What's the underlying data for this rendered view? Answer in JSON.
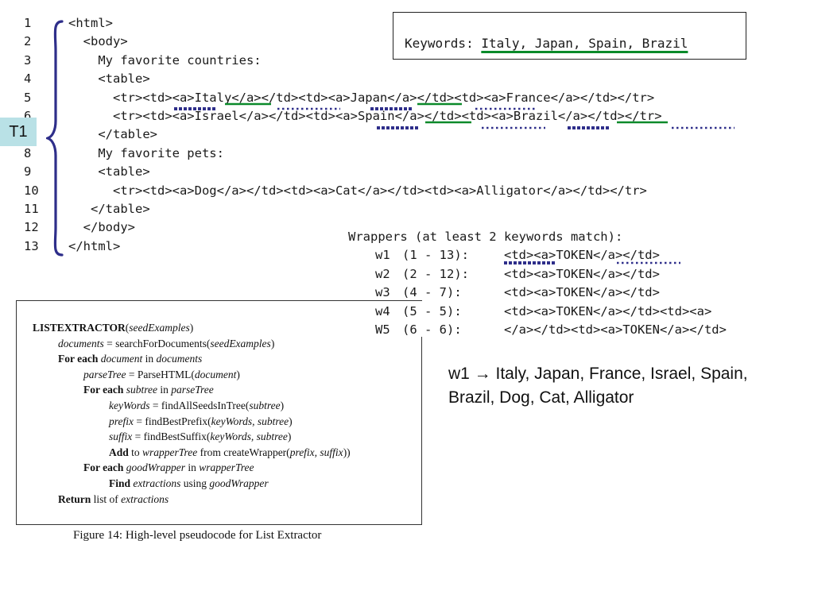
{
  "code": {
    "lines": [
      {
        "num": "1",
        "text": "<html>"
      },
      {
        "num": "2",
        "text": "  <body>"
      },
      {
        "num": "3",
        "text": "    My favorite countries:"
      },
      {
        "num": "4",
        "text": "    <table>"
      },
      {
        "num": "5",
        "text": "      <tr><td><a>Italy</a></td><td><a>Japan</a></td><td><a>France</a></td></tr>"
      },
      {
        "num": "6",
        "text": "      <tr><td><a>Israel</a></td><td><a>Spain</a></td><td><a>Brazil</a></td></tr>"
      },
      {
        "num": "7",
        "text": "    </table>"
      },
      {
        "num": "8",
        "text": "    My favorite pets:"
      },
      {
        "num": "9",
        "text": "    <table>"
      },
      {
        "num": "10",
        "text": "      <tr><td><a>Dog</a></td><td><a>Cat</a></td><td><a>Alligator</a></td></tr>"
      },
      {
        "num": "11",
        "text": "   </table>"
      },
      {
        "num": "12",
        "text": "  </body>"
      },
      {
        "num": "13",
        "text": "</html>"
      }
    ]
  },
  "tree_label": "T1",
  "keywords": {
    "label": "Keywords: ",
    "items": "Italy, Japan, Spain, Brazil"
  },
  "wrappers": {
    "header": "Wrappers (at least 2 keywords match):",
    "items": [
      {
        "name": "w1",
        "range": "(1 - 13):",
        "pattern": "<td><a>TOKEN</a></td>"
      },
      {
        "name": "w2",
        "range": "(2 - 12):",
        "pattern": "<td><a>TOKEN</a></td>"
      },
      {
        "name": "w3",
        "range": "(4 - 7):",
        "pattern": "<td><a>TOKEN</a></td>"
      },
      {
        "name": "w4",
        "range": "(5 - 5):",
        "pattern": "<td><a>TOKEN</a></td><td><a>"
      },
      {
        "name": "W5",
        "range": "(6 - 6):",
        "pattern": "</a></td><td><a>TOKEN</a></td>"
      }
    ]
  },
  "pseudocode": {
    "lines": [
      {
        "indent": 0,
        "parts": [
          {
            "t": "LISTEXTRACTOR",
            "s": "b"
          },
          {
            "t": "(",
            "s": ""
          },
          {
            "t": "seedExamples",
            "s": "i"
          },
          {
            "t": ")",
            "s": ""
          }
        ]
      },
      {
        "indent": 1,
        "parts": [
          {
            "t": "documents",
            "s": "i"
          },
          {
            "t": " = searchForDocuments(",
            "s": ""
          },
          {
            "t": "seedExamples",
            "s": "i"
          },
          {
            "t": ")",
            "s": ""
          }
        ]
      },
      {
        "indent": 1,
        "parts": [
          {
            "t": "For each",
            "s": "b"
          },
          {
            "t": " ",
            "s": ""
          },
          {
            "t": "document",
            "s": "i"
          },
          {
            "t": " in ",
            "s": ""
          },
          {
            "t": "documents",
            "s": "i"
          }
        ]
      },
      {
        "indent": 2,
        "parts": [
          {
            "t": "parseTree",
            "s": "i"
          },
          {
            "t": " = ParseHTML(",
            "s": ""
          },
          {
            "t": "document",
            "s": "i"
          },
          {
            "t": ")",
            "s": ""
          }
        ]
      },
      {
        "indent": 2,
        "parts": [
          {
            "t": "For each",
            "s": "b"
          },
          {
            "t": " ",
            "s": ""
          },
          {
            "t": "subtree",
            "s": "i"
          },
          {
            "t": " in ",
            "s": ""
          },
          {
            "t": "parseTree",
            "s": "i"
          }
        ]
      },
      {
        "indent": 3,
        "parts": [
          {
            "t": "keyWords",
            "s": "i"
          },
          {
            "t": " = findAllSeedsInTree(",
            "s": ""
          },
          {
            "t": "subtree",
            "s": "i"
          },
          {
            "t": ")",
            "s": ""
          }
        ]
      },
      {
        "indent": 3,
        "parts": [
          {
            "t": "prefix",
            "s": "i"
          },
          {
            "t": " = findBestPrefix(",
            "s": ""
          },
          {
            "t": "keyWords, subtree",
            "s": "i"
          },
          {
            "t": ")",
            "s": ""
          }
        ]
      },
      {
        "indent": 3,
        "parts": [
          {
            "t": "suffix",
            "s": "i"
          },
          {
            "t": " = findBestSuffix(",
            "s": ""
          },
          {
            "t": "keyWords, subtree",
            "s": "i"
          },
          {
            "t": ")",
            "s": ""
          }
        ]
      },
      {
        "indent": 3,
        "parts": [
          {
            "t": "Add",
            "s": "b"
          },
          {
            "t": " to ",
            "s": ""
          },
          {
            "t": "wrapperTree",
            "s": "i"
          },
          {
            "t": " from createWrapper(",
            "s": ""
          },
          {
            "t": "prefix, suffix",
            "s": "i"
          },
          {
            "t": "))",
            "s": ""
          }
        ]
      },
      {
        "indent": 2,
        "parts": [
          {
            "t": "For each",
            "s": "b"
          },
          {
            "t": " ",
            "s": ""
          },
          {
            "t": "goodWrapper",
            "s": "i"
          },
          {
            "t": " in ",
            "s": ""
          },
          {
            "t": "wrapperTree",
            "s": "i"
          }
        ]
      },
      {
        "indent": 3,
        "parts": [
          {
            "t": "Find",
            "s": "b"
          },
          {
            "t": " ",
            "s": ""
          },
          {
            "t": "extractions",
            "s": "i"
          },
          {
            "t": " using ",
            "s": ""
          },
          {
            "t": "goodWrapper",
            "s": "i"
          }
        ]
      },
      {
        "indent": 1,
        "parts": [
          {
            "t": "Return",
            "s": "b"
          },
          {
            "t": " list of ",
            "s": ""
          },
          {
            "t": "extractions",
            "s": "i"
          }
        ]
      }
    ],
    "caption": "Figure 14: High-level pseudocode for List Extractor"
  },
  "result": {
    "text": "w1 → Italy, Japan, France, Israel, Spain, Brazil, Dog, Cat, Alligator"
  },
  "colors": {
    "brace": "#2e2e8a",
    "keyword_underline": "#0a8a2a",
    "marker_blue": "#2e2e8a",
    "t1_background": "#b9e1e6"
  }
}
